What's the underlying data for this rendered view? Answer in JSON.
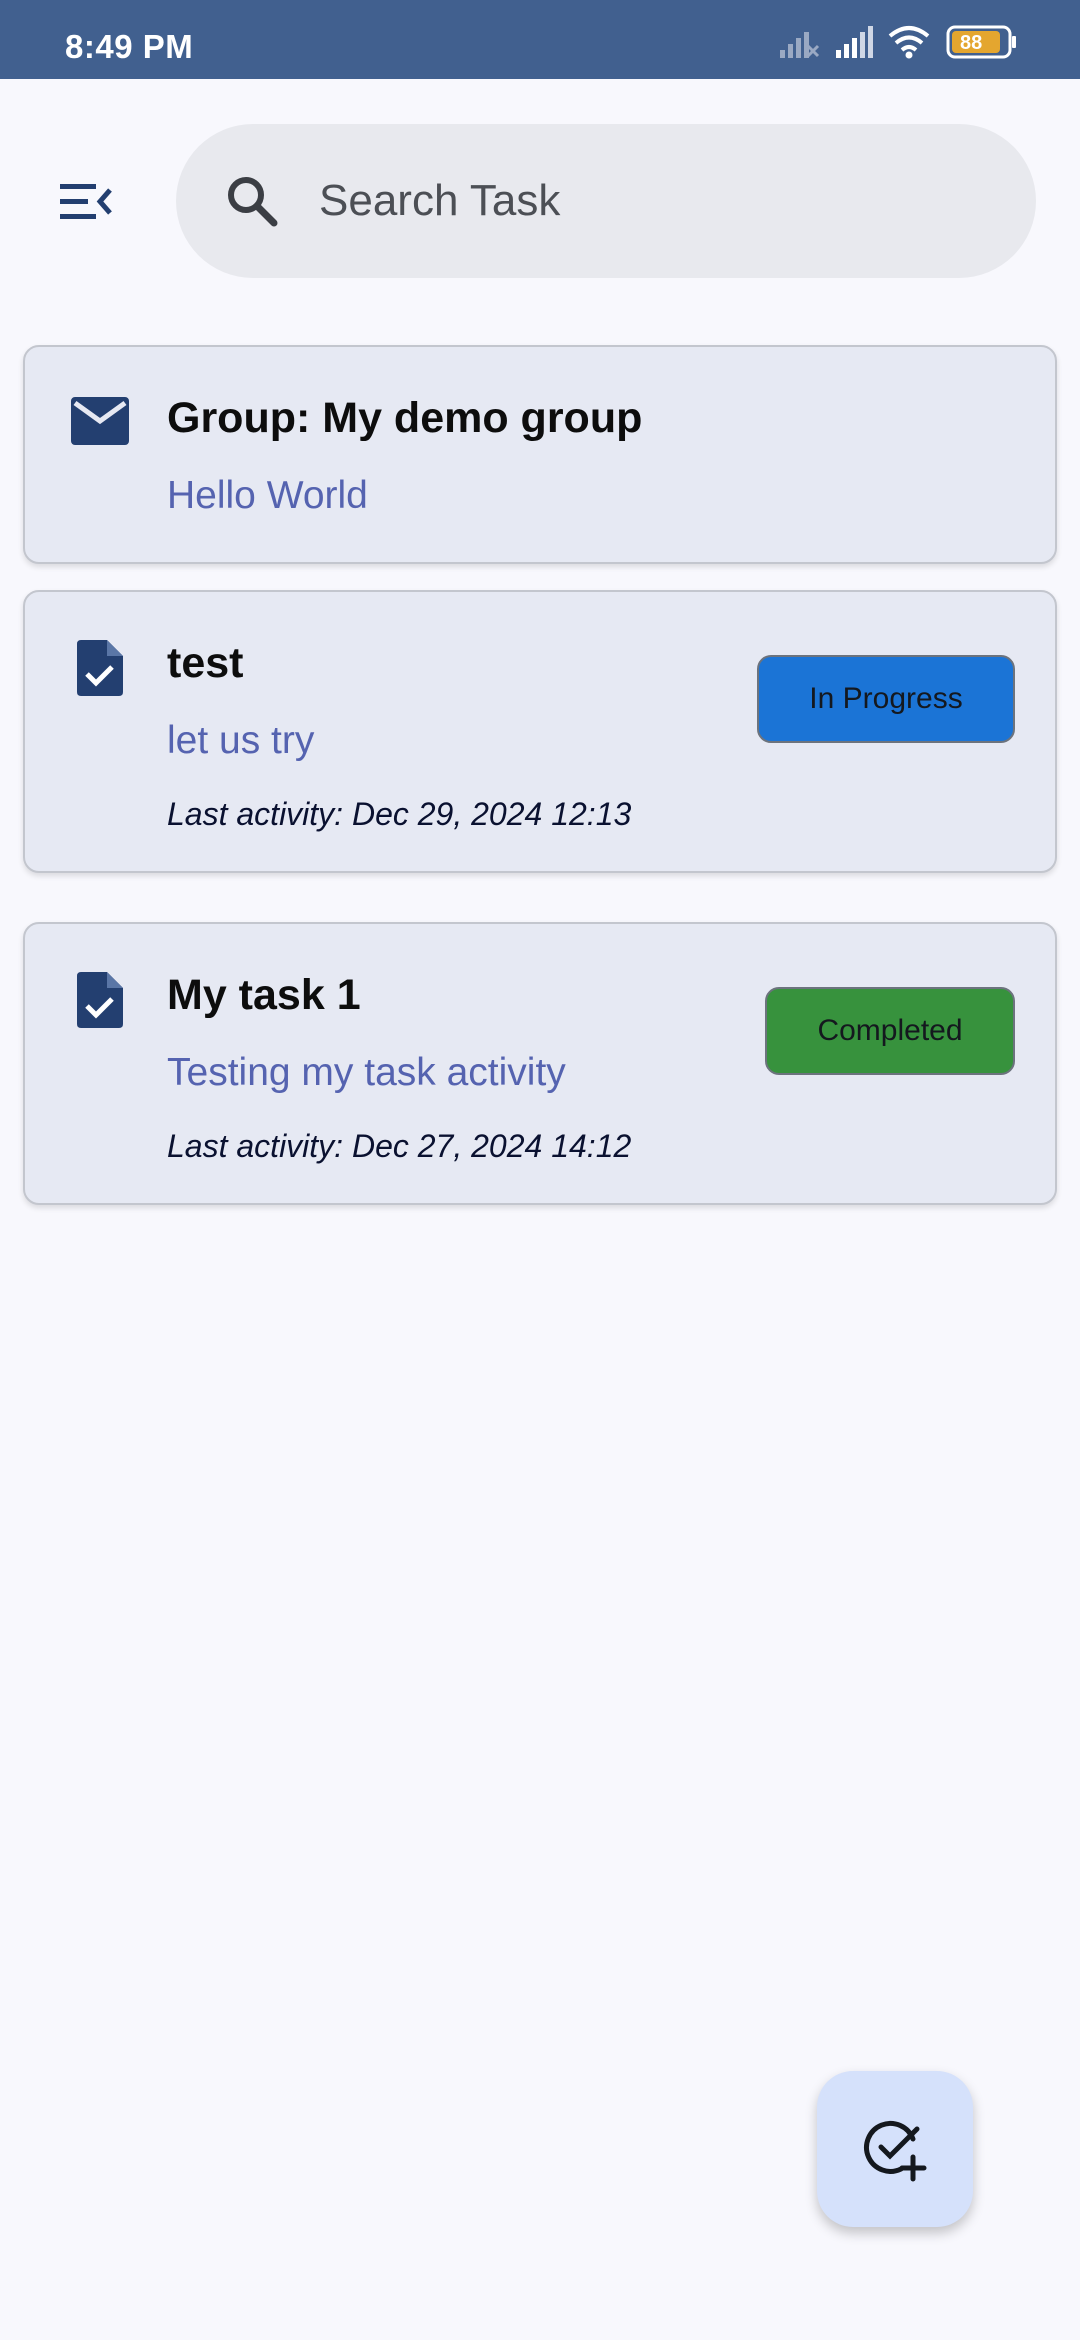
{
  "status_bar": {
    "time": "8:49 PM",
    "battery_level": "88",
    "icons": [
      "signal-off-icon",
      "signal-icon",
      "wifi-icon",
      "battery-icon"
    ]
  },
  "toolbar": {
    "menu_icon": "menu-open-icon",
    "search": {
      "placeholder": "Search Task",
      "icon": "search-icon"
    }
  },
  "groups": [
    {
      "title": "Group: My demo group",
      "message": "Hello World",
      "icon": "mail-icon"
    }
  ],
  "tasks": [
    {
      "title": "test",
      "description": "let us try",
      "last_activity": "Last activity: Dec 29, 2024 12:13",
      "status": "In Progress",
      "status_color": "#1b74d6",
      "icon": "task-file-check-icon"
    },
    {
      "title": "My task 1",
      "description": "Testing my task activity",
      "last_activity": "Last activity: Dec 27, 2024 14:12",
      "status": "Completed",
      "status_color": "#37923d",
      "icon": "task-file-check-icon"
    }
  ],
  "fab": {
    "icon": "add-task-icon"
  },
  "colors": {
    "status_bar": "#41608f",
    "icon_primary": "#233f70",
    "card_bg": "#e6e9f3",
    "subtitle": "#5563b0",
    "fab_bg": "#d5e1fb"
  }
}
